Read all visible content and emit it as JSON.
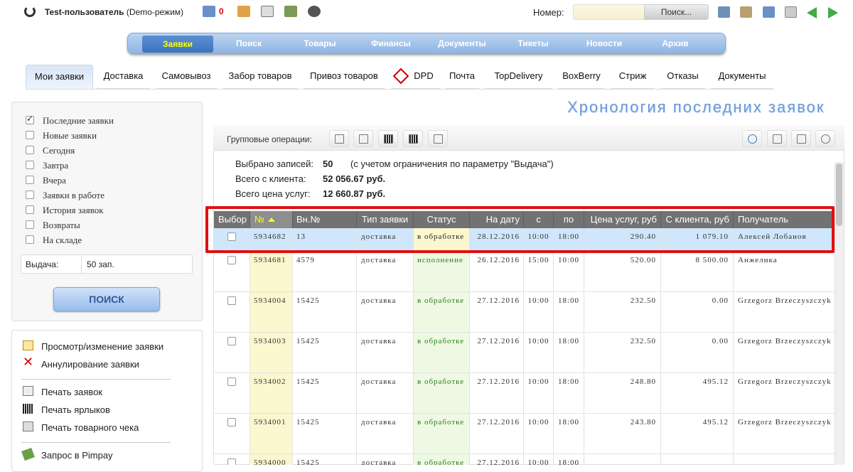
{
  "header": {
    "user": "Test-пользователь",
    "mode": "(Demo-режим)",
    "mail_count": "0",
    "nomer_label": "Номер:",
    "search_button": "Поиск..."
  },
  "main_nav": [
    "Заявки",
    "Поиск",
    "Товары",
    "Финансы",
    "Документы",
    "Тикеты",
    "Новости",
    "Архив"
  ],
  "sub_tabs": [
    "Мои заявки",
    "Доставка",
    "Самовывоз",
    "Забор товаров",
    "Привоз товаров",
    "DPD",
    "Почта",
    "TopDelivery",
    "BoxBerry",
    "Стриж",
    "Отказы",
    "Документы"
  ],
  "filters": [
    {
      "label": "Последние заявки",
      "checked": true
    },
    {
      "label": "Новые заявки",
      "checked": false
    },
    {
      "label": "Сегодня",
      "checked": false
    },
    {
      "label": "Завтра",
      "checked": false
    },
    {
      "label": "Вчера",
      "checked": false
    },
    {
      "label": "Заявки в работе",
      "checked": false
    },
    {
      "label": "История заявок",
      "checked": false
    },
    {
      "label": "Возвраты",
      "checked": false
    },
    {
      "label": "На складе",
      "checked": false
    }
  ],
  "vydacha": {
    "label": "Выдача:",
    "value": "50 зап."
  },
  "search_label": "ПОИСК",
  "actions": [
    "Просмотр/изменение заявки",
    "Аннулирование заявки",
    "Печать заявок",
    "Печать ярлыков",
    "Печать товарного чека",
    "Запрос в Pimpay"
  ],
  "page_title": "Хронология последних заявок",
  "group_ops": "Групповые операции:",
  "stats": {
    "selected_label": "Выбрано записей:",
    "selected_value": "50",
    "selected_note": "(с учетом ограничения по параметру \"Выдача\")",
    "client_label": "Всего с клиента:",
    "client_value": "52 056.67 руб.",
    "services_label": "Всего цена услуг:",
    "services_value": "12 660.87 руб."
  },
  "columns": [
    "Выбор",
    "№",
    "Вн.№",
    "Тип заявки",
    "Статус",
    "На дату",
    "с",
    "по",
    "Цена услуг, руб",
    "С клиента, руб",
    "Получатель"
  ],
  "rows": [
    [
      "5934682",
      "13",
      "доставка",
      "в обработке",
      "28.12.2016",
      "10:00",
      "18:00",
      "290.40",
      "1 079.10",
      "Алексей Лобанов"
    ],
    [
      "5934681",
      "4579",
      "доставка",
      "исполнение",
      "26.12.2016",
      "15:00",
      "10:00",
      "520.00",
      "8 500.00",
      "Анжелика"
    ],
    [
      "5934004",
      "15425",
      "доставка",
      "в обработке",
      "27.12.2016",
      "10:00",
      "18:00",
      "232.50",
      "0.00",
      "Grzegorz Brzeczyszczyk"
    ],
    [
      "5934003",
      "15425",
      "доставка",
      "в обработке",
      "27.12.2016",
      "10:00",
      "18:00",
      "232.50",
      "0.00",
      "Grzegorz Brzeczyszczyk"
    ],
    [
      "5934002",
      "15425",
      "доставка",
      "в обработке",
      "27.12.2016",
      "10:00",
      "18:00",
      "248.80",
      "495.12",
      "Grzegorz Brzeczyszczyk"
    ],
    [
      "5934001",
      "15425",
      "доставка",
      "в обработке",
      "27.12.2016",
      "10:00",
      "18:00",
      "243.80",
      "495.12",
      "Grzegorz Brzeczyszczyk"
    ],
    [
      "5934000",
      "15425",
      "доставка",
      "в обработке",
      "27.12.2016",
      "10:00",
      "18:00",
      "",
      "",
      ""
    ]
  ],
  "colors": {
    "accent": "#6a9ad8",
    "nav": "#8fb4e4",
    "highlight": "#e01010"
  }
}
